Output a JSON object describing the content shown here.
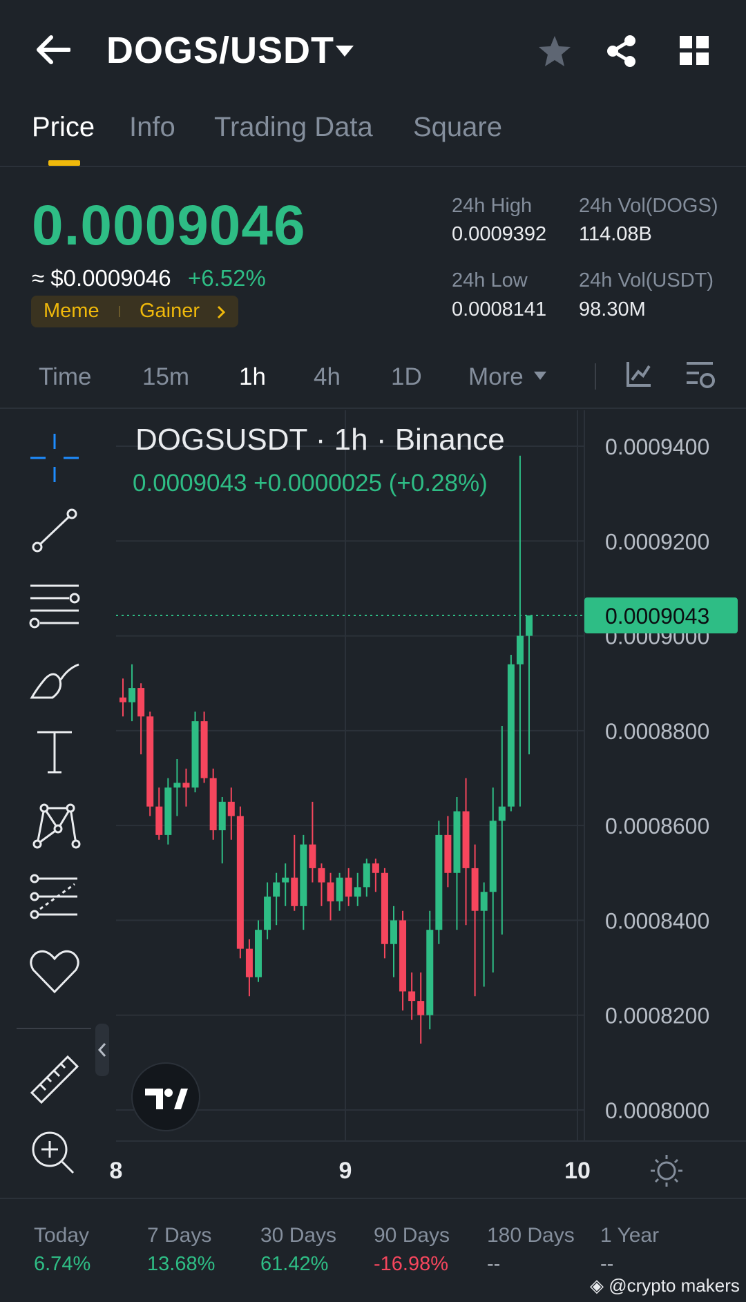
{
  "header": {
    "pair": "DOGS/USDT"
  },
  "tabs": [
    "Price",
    "Info",
    "Trading Data",
    "Square"
  ],
  "price": {
    "last": "0.0009046",
    "usd": "≈ $0.0009046",
    "change": "+6.52%",
    "tags": [
      "Meme",
      "Gainer"
    ],
    "stats": {
      "high_label": "24h High",
      "high": "0.0009392",
      "volb_label": "24h Vol(DOGS)",
      "volb": "114.08B",
      "low_label": "24h Low",
      "low": "0.0008141",
      "volq_label": "24h Vol(USDT)",
      "volq": "98.30M"
    }
  },
  "timeframes": [
    "Time",
    "15m",
    "1h",
    "4h",
    "1D",
    "More"
  ],
  "chart_data": {
    "type": "candlestick",
    "title": "DOGSUSDT · 1h · Binance",
    "ohlc_line": "0.0009043  +0.0000025 (+0.28%)",
    "current_price": "0.0009043",
    "y_ticks": [
      "0.0009400",
      "0.0009200",
      "0.0009000",
      "0.0008800",
      "0.0008600",
      "0.0008400",
      "0.0008200",
      "0.0008000"
    ],
    "ylim": [
      0.000783,
      0.000946
    ],
    "x_ticks": [
      "8",
      "9",
      "10"
    ],
    "candles": [
      [
        0.000887,
        0.000891,
        0.000883,
        0.000886
      ],
      [
        0.000886,
        0.000894,
        0.000882,
        0.000889
      ],
      [
        0.000889,
        0.00089,
        0.000875,
        0.000883
      ],
      [
        0.000883,
        0.000884,
        0.000862,
        0.000864
      ],
      [
        0.000864,
        0.000868,
        0.000857,
        0.000858
      ],
      [
        0.000858,
        0.00087,
        0.000856,
        0.000868
      ],
      [
        0.000868,
        0.000874,
        0.000862,
        0.000869
      ],
      [
        0.000869,
        0.000872,
        0.000864,
        0.000868
      ],
      [
        0.000868,
        0.000884,
        0.000867,
        0.000882
      ],
      [
        0.000882,
        0.000884,
        0.000869,
        0.00087
      ],
      [
        0.00087,
        0.000872,
        0.000857,
        0.000859
      ],
      [
        0.000859,
        0.000866,
        0.000852,
        0.000865
      ],
      [
        0.000865,
        0.000868,
        0.000857,
        0.000862
      ],
      [
        0.000862,
        0.000864,
        0.000832,
        0.000834
      ],
      [
        0.000834,
        0.000836,
        0.000824,
        0.000828
      ],
      [
        0.000828,
        0.00084,
        0.000827,
        0.000838
      ],
      [
        0.000838,
        0.000848,
        0.000836,
        0.000845
      ],
      [
        0.000845,
        0.00085,
        0.000839,
        0.000848
      ],
      [
        0.000848,
        0.000852,
        0.000843,
        0.000849
      ],
      [
        0.000849,
        0.000858,
        0.000842,
        0.000843
      ],
      [
        0.000843,
        0.000858,
        0.000838,
        0.000856
      ],
      [
        0.000856,
        0.000865,
        0.000848,
        0.000851
      ],
      [
        0.000851,
        0.000852,
        0.000843,
        0.000848
      ],
      [
        0.000848,
        0.00085,
        0.00084,
        0.000844
      ],
      [
        0.000844,
        0.00085,
        0.000842,
        0.000849
      ],
      [
        0.000849,
        0.000851,
        0.000843,
        0.000845
      ],
      [
        0.000845,
        0.00085,
        0.000843,
        0.000847
      ],
      [
        0.000847,
        0.000853,
        0.000845,
        0.000852
      ],
      [
        0.000852,
        0.000853,
        0.000846,
        0.00085
      ],
      [
        0.00085,
        0.000851,
        0.000832,
        0.000835
      ],
      [
        0.000835,
        0.000843,
        0.000828,
        0.00084
      ],
      [
        0.00084,
        0.000842,
        0.000821,
        0.000825
      ],
      [
        0.000825,
        0.000829,
        0.000819,
        0.000823
      ],
      [
        0.000823,
        0.000829,
        0.000814,
        0.00082
      ],
      [
        0.00082,
        0.000842,
        0.000817,
        0.000838
      ],
      [
        0.000838,
        0.000861,
        0.000835,
        0.000858
      ],
      [
        0.000858,
        0.000862,
        0.000847,
        0.00085
      ],
      [
        0.00085,
        0.000866,
        0.000838,
        0.000863
      ],
      [
        0.000863,
        0.00087,
        0.000839,
        0.000851
      ],
      [
        0.000851,
        0.000856,
        0.000824,
        0.000842
      ],
      [
        0.000842,
        0.000848,
        0.000826,
        0.000846
      ],
      [
        0.000846,
        0.000868,
        0.000829,
        0.000861
      ],
      [
        0.000861,
        0.000881,
        0.000837,
        0.000864
      ],
      [
        0.000864,
        0.000896,
        0.000863,
        0.000894
      ],
      [
        0.000894,
        0.000938,
        0.000864,
        0.0009
      ],
      [
        0.0009,
        0.000903,
        0.000875,
        0.0009043
      ]
    ]
  },
  "periods": [
    {
      "label": "Today",
      "value": "6.74%",
      "dir": "up"
    },
    {
      "label": "7 Days",
      "value": "13.68%",
      "dir": "up"
    },
    {
      "label": "30 Days",
      "value": "61.42%",
      "dir": "up"
    },
    {
      "label": "90 Days",
      "value": "-16.98%",
      "dir": "down"
    },
    {
      "label": "180 Days",
      "value": "--",
      "dir": "flat"
    },
    {
      "label": "1 Year",
      "value": "--",
      "dir": "flat"
    }
  ],
  "watermark": "@crypto makers",
  "colors": {
    "up": "#2ebd85",
    "down": "#f6465d",
    "accent": "#f0b90b",
    "bg": "#1e2329"
  }
}
